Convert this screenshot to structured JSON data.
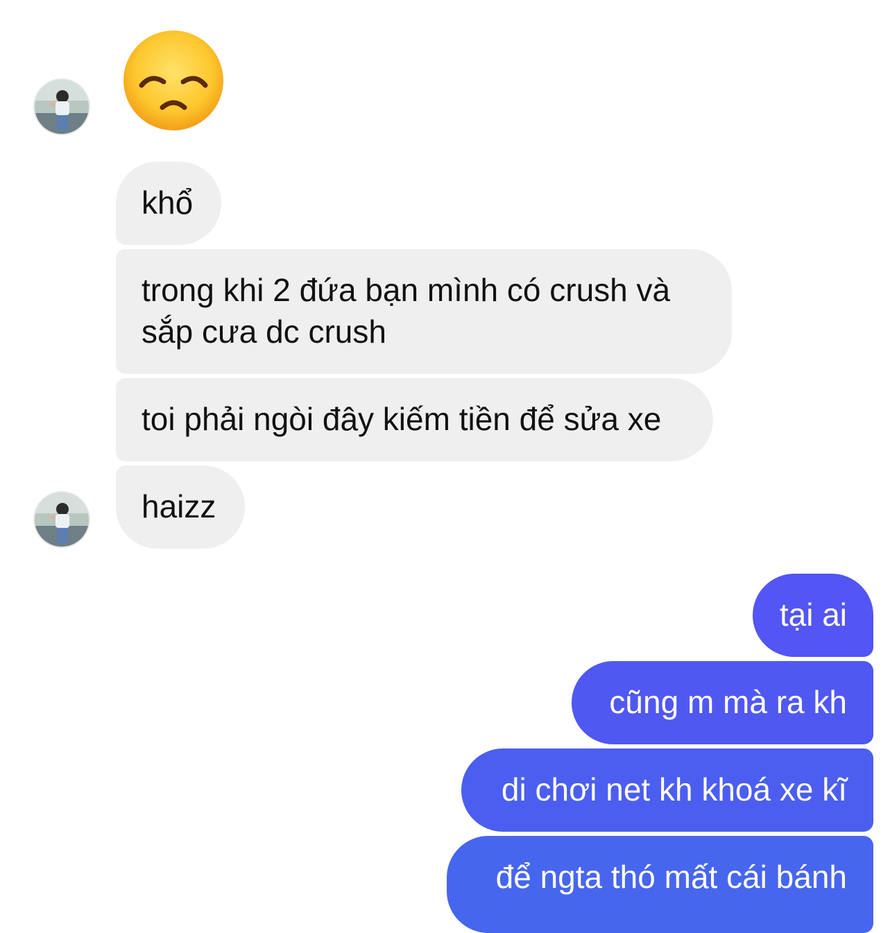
{
  "colors": {
    "incoming_bubble": "#efefef",
    "incoming_text": "#111111",
    "outgoing_gradient": [
      "#5355f5",
      "#4766ee"
    ],
    "outgoing_text": "#ffffff"
  },
  "emoji": {
    "icon": "disappointed-face-emoji"
  },
  "incoming_messages": [
    {
      "text": "khổ"
    },
    {
      "text": "trong khi 2 đứa bạn mình có crush và sắp cưa dc crush"
    },
    {
      "text": "toi phải ngòi đây kiếm tiền để sửa xe"
    },
    {
      "text": "haizz"
    }
  ],
  "outgoing_messages": [
    {
      "text": "tại ai"
    },
    {
      "text": "cũng m mà ra kh"
    },
    {
      "text": "di chơi net kh khoá xe kĩ"
    },
    {
      "text": "để ngta thó mất cái bánh"
    }
  ]
}
